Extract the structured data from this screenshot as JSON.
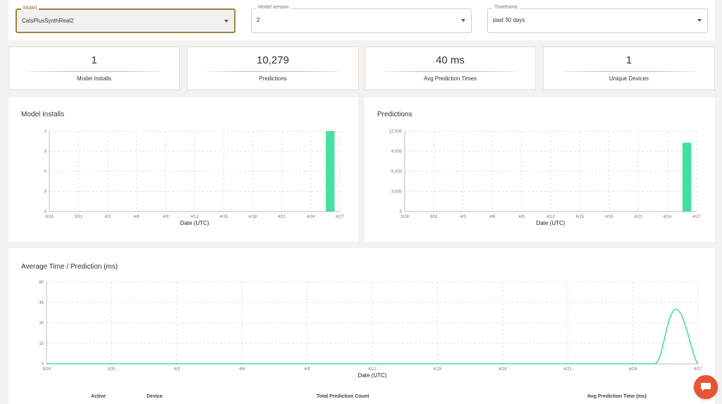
{
  "filters": {
    "model": {
      "label": "Model",
      "value": "CatsPlusSynthReal2"
    },
    "version": {
      "label": "Model version",
      "value": "2"
    },
    "timeframe": {
      "label": "Timeframe",
      "value": "past 30 days"
    }
  },
  "stats": [
    {
      "value": "1",
      "label": "Model Installs"
    },
    {
      "value": "10,279",
      "label": "Predictions"
    },
    {
      "value": "40 ms",
      "label": "Avg Prediction Times"
    },
    {
      "value": "1",
      "label": "Unique Devices"
    }
  ],
  "chart_data": [
    {
      "type": "bar",
      "title": "Model Installs",
      "xlabel": "Date (UTC)",
      "ylabel": "",
      "x_ticks": [
        "3/28",
        "3/31",
        "4/3",
        "4/6",
        "4/9",
        "4/12",
        "4/15",
        "4/18",
        "4/21",
        "4/24",
        "4/27"
      ],
      "y_ticks": [
        "0",
        "0",
        "0",
        "0",
        "1"
      ],
      "ylim": [
        0,
        1
      ],
      "bar_color": "#45e0a0",
      "points": [
        {
          "x": "4/26",
          "y": 1
        }
      ]
    },
    {
      "type": "bar",
      "title": "Predictions",
      "xlabel": "Date (UTC)",
      "ylabel": "",
      "x_ticks": [
        "3/28",
        "3/31",
        "4/3",
        "4/6",
        "4/9",
        "4/12",
        "4/15",
        "4/18",
        "4/21",
        "4/24",
        "4/27"
      ],
      "y_ticks": [
        "0",
        "3,000",
        "6,000",
        "9,000",
        "12,000"
      ],
      "ylim": [
        0,
        12000
      ],
      "bar_color": "#45e0a0",
      "points": [
        {
          "x": "4/26",
          "y": 10279
        }
      ]
    },
    {
      "type": "line",
      "title": "Average Time / Prediction (ms)",
      "xlabel": "Date (UTC)",
      "ylabel": "",
      "x_ticks": [
        "3/28",
        "3/31",
        "4/3",
        "4/6",
        "4/9",
        "4/12",
        "4/15",
        "4/18",
        "4/21",
        "4/24",
        "4/27"
      ],
      "y_ticks": [
        "0",
        "15",
        "30",
        "45",
        "60"
      ],
      "ylim": [
        0,
        60
      ],
      "line_color": "#45e0a0",
      "x": [
        "3/28",
        "4/25",
        "4/26",
        "4/27"
      ],
      "y": [
        0,
        0,
        40,
        0
      ]
    }
  ],
  "table": {
    "headers": [
      "Active",
      "Device",
      "Total Prediction Count",
      "Avg Prediction Time (ms)"
    ]
  },
  "icons": {
    "chat": "chat-bubble-icon",
    "dropdown": "caret-down-icon"
  }
}
